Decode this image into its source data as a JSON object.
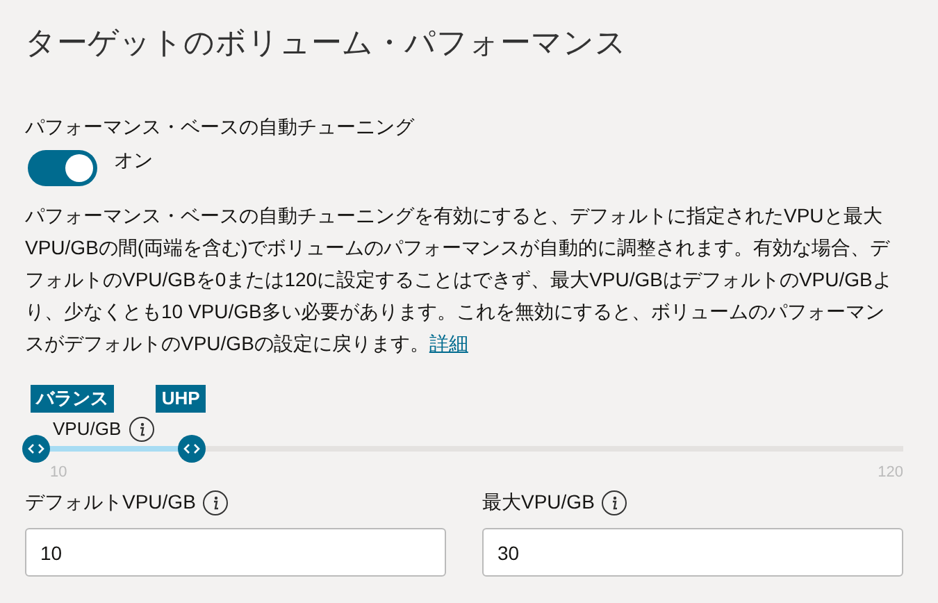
{
  "title": "ターゲットのボリューム・パフォーマンス",
  "auto_tuning": {
    "label": "パフォーマンス・ベースの自動チューニング",
    "on": true,
    "state_text": "オン"
  },
  "description": {
    "text": "パフォーマンス・ベースの自動チューニングを有効にすると、デフォルトに指定されたVPUと最大VPU/GBの間(両端を含む)でボリュームのパフォーマンスが自動的に調整されます。有効な場合、デフォルトのVPU/GBを0または120に設定することはできず、最大VPU/GBはデフォルトのVPU/GBより、少なくとも10 VPU/GB多い必要があります。これを無効にすると、ボリュームのパフォーマンスがデフォルトのVPU/GBの設定に戻ります。",
    "link": "詳細"
  },
  "slider": {
    "label": "VPU/GB",
    "min_label": "10",
    "max_label": "120",
    "thumbs": [
      {
        "tag": "バランス",
        "level": 0
      },
      {
        "tag": "UHP",
        "level": 0.18
      }
    ]
  },
  "fields": [
    {
      "label": "デフォルトVPU/GB",
      "value": "10"
    },
    {
      "label": "最大VPU/GB",
      "value": "30"
    }
  ]
}
